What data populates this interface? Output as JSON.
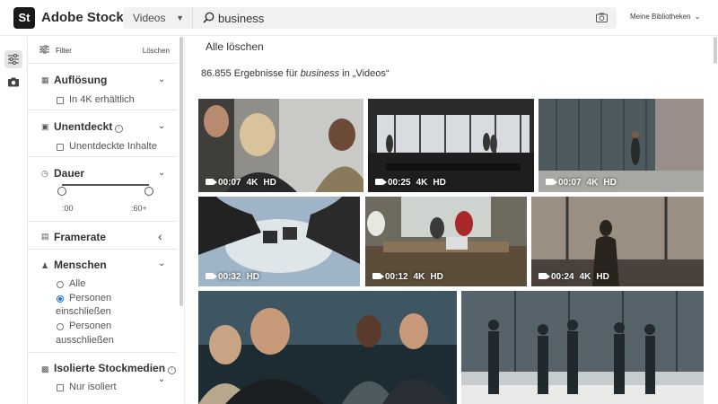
{
  "header": {
    "logo": "St",
    "brand": "Adobe Stock",
    "type_select": "Videos",
    "search_value": "business",
    "libraries": "Meine Bibliotheken"
  },
  "filters": {
    "title": "Filter",
    "clear": "Löschen",
    "resolution": {
      "title": "Auflösung",
      "option": "In 4K erhältlich"
    },
    "undiscovered": {
      "title": "Unentdeckt",
      "option": "Unentdeckte Inhalte"
    },
    "duration": {
      "title": "Dauer",
      "min": ":00",
      "max": ":60+"
    },
    "framerate": {
      "title": "Framerate"
    },
    "people": {
      "title": "Menschen",
      "options": [
        "Alle",
        "Personen einschließen",
        "Personen ausschließen"
      ],
      "opt2_line1": "Personen",
      "opt2_line2": "einschließen",
      "opt3_line1": "Personen",
      "opt3_line2": "ausschließen",
      "selected": "Personen einschließen"
    },
    "isolated": {
      "title": "Isolierte Stockmedien",
      "option": "Nur isoliert"
    }
  },
  "main": {
    "clear_all": "Alle löschen",
    "results_prefix": "86.855 Ergebnisse für ",
    "results_keyword": "business",
    "results_suffix": " in „Videos“"
  },
  "videos": [
    {
      "duration": "00:07",
      "res": "4K",
      "quality": "HD"
    },
    {
      "duration": "00:25",
      "res": "4K",
      "quality": "HD"
    },
    {
      "duration": "00:07",
      "res": "4K",
      "quality": "HD"
    },
    {
      "duration": "00:32",
      "res": "",
      "quality": "HD"
    },
    {
      "duration": "00:12",
      "res": "4K",
      "quality": "HD"
    },
    {
      "duration": "00:24",
      "res": "4K",
      "quality": "HD"
    },
    {
      "duration": "",
      "res": "",
      "quality": ""
    },
    {
      "duration": "",
      "res": "",
      "quality": ""
    }
  ],
  "colors": {
    "accent": "#1473e6",
    "header_bg": "#ffffff",
    "search_bg": "#f1f1f1"
  },
  "icons": [
    "search-icon",
    "camera-icon",
    "filter-icon",
    "chevron-down-icon",
    "info-icon",
    "video-camera-icon"
  ]
}
